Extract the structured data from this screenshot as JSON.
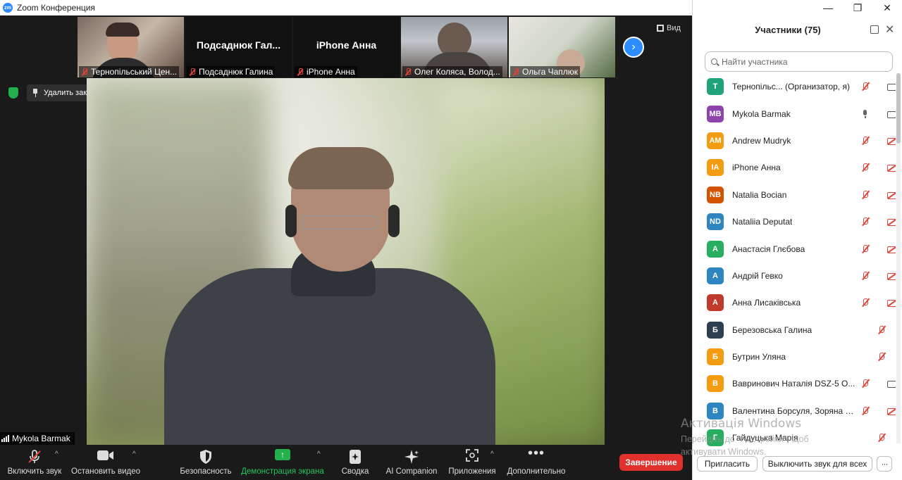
{
  "app": {
    "title": "Zoom Конференция"
  },
  "thumbnails": [
    {
      "label": "Тернопільський Цен..."
    },
    {
      "bigname": "Подсаднюк  Гал...",
      "label": "Подсаднюк Галина"
    },
    {
      "bigname": "iPhone Анна",
      "label": "iPhone Анна"
    },
    {
      "label": "Олег Коляса, Волод..."
    },
    {
      "label": "Ольга Чаплюк"
    }
  ],
  "view_label": "Вид",
  "unpin_label": "Удалить закрепление",
  "active_speaker": "Mykola Barmak",
  "toolbar": {
    "unmute": "Включить звук",
    "stop_video": "Остановить видео",
    "security": "Безопасность",
    "share": "Демонстрация экрана",
    "summary": "Сводка",
    "ai": "AI Companion",
    "apps": "Приложения",
    "more": "Дополнительно",
    "end": "Завершение"
  },
  "panel": {
    "title": "Участники (75)",
    "search_placeholder": "Найти участника",
    "participants": [
      {
        "initials": "T",
        "color": "#1fa37a",
        "name": "Тернопільс...  (Организатор, я)",
        "mic": "off",
        "cam": "on"
      },
      {
        "initials": "MB",
        "color": "#8e44ad",
        "name": "Mykola Barmak",
        "mic": "on",
        "cam": "on"
      },
      {
        "initials": "AM",
        "color": "#f39c12",
        "name": "Andrew Mudryk",
        "mic": "off",
        "cam": "off"
      },
      {
        "initials": "IA",
        "color": "#f39c12",
        "name": "iPhone Анна",
        "mic": "off",
        "cam": "off"
      },
      {
        "initials": "NB",
        "color": "#d35400",
        "name": "Natalia Bocian",
        "mic": "off",
        "cam": "off"
      },
      {
        "initials": "ND",
        "color": "#2e86c1",
        "name": "Nataliia Deputat",
        "mic": "off",
        "cam": "off"
      },
      {
        "initials": "А",
        "color": "#27ae60",
        "name": "Анастасія Глєбова",
        "mic": "off",
        "cam": "off"
      },
      {
        "initials": "А",
        "color": "#2e86c1",
        "name": "Андрій Гевко",
        "mic": "off",
        "cam": "off"
      },
      {
        "initials": "А",
        "color": "#c0392b",
        "name": "Анна Лисаківська",
        "mic": "off",
        "cam": "off"
      },
      {
        "initials": "Б",
        "color": "#2c3e50",
        "name": "Березовська Галина",
        "mic": "off",
        "cam": "none"
      },
      {
        "initials": "Б",
        "color": "#f39c12",
        "name": "Бутрин Уляна",
        "mic": "off",
        "cam": "none"
      },
      {
        "initials": "В",
        "color": "#f39c12",
        "name": "Вавринович Наталія DSZ-5 О...",
        "mic": "off",
        "cam": "on"
      },
      {
        "initials": "В",
        "color": "#2e86c1",
        "name": "Валентина Борсуля, Зоряна М...",
        "mic": "off",
        "cam": "off"
      },
      {
        "initials": "Г",
        "color": "#27ae60",
        "name": "Гайдуцька Марія",
        "mic": "off",
        "cam": "none"
      }
    ],
    "invite": "Пригласить",
    "mute_all": "Выключить звук для всех"
  },
  "watermark": {
    "line1": "Активація Windows",
    "line2": "Перейдіть до \"Настройки\", щоб",
    "line3": "активувати Windows."
  },
  "colors": {
    "accent": "#2d8cff",
    "end": "#e0312c",
    "share": "#22b14c"
  }
}
